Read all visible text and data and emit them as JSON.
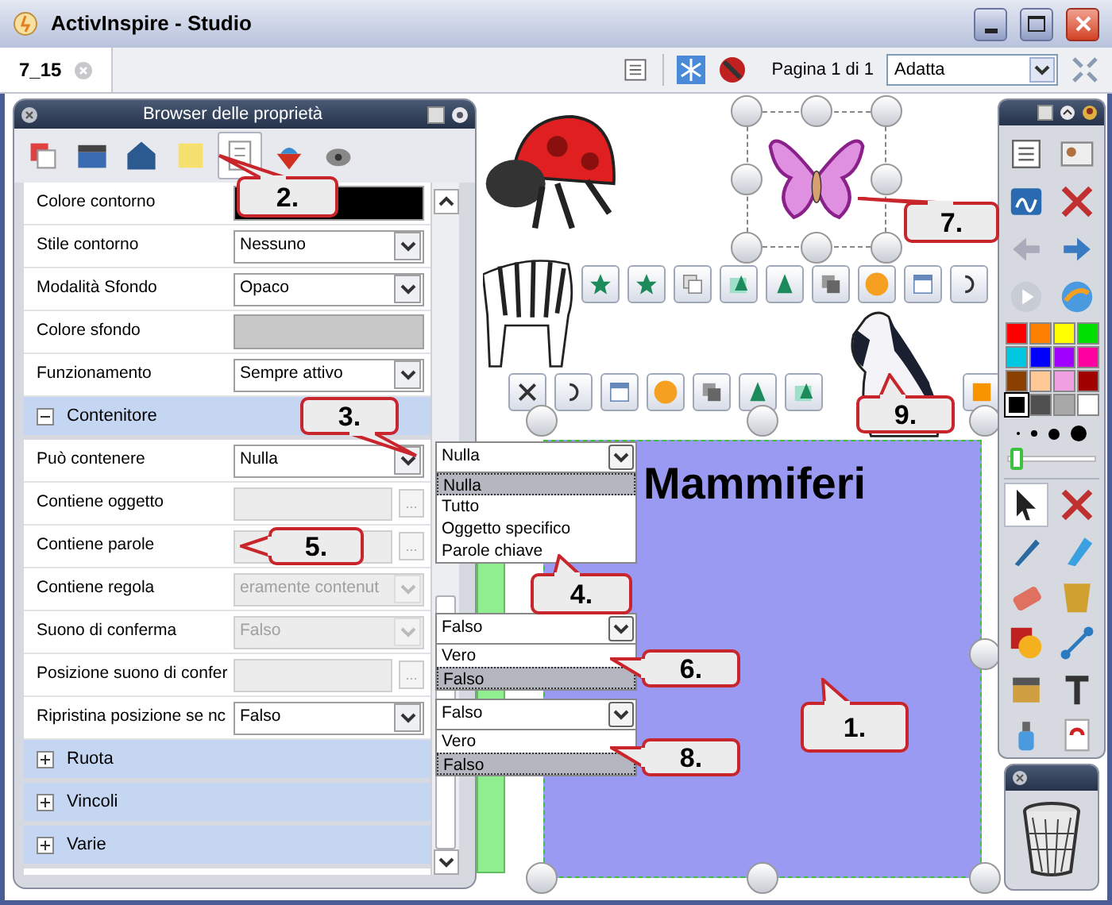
{
  "window": {
    "title": "ActivInspire - Studio"
  },
  "tabs": [
    {
      "label": "7_15",
      "selected": true
    }
  ],
  "toolbar": {
    "page_label": "Pagina 1 di 1",
    "zoom": "Adatta"
  },
  "property_browser": {
    "title": "Browser delle proprietà",
    "tabs": [
      {
        "selected": false
      },
      {
        "selected": false
      },
      {
        "selected": false
      },
      {
        "selected": false
      },
      {
        "selected": true
      },
      {
        "selected": false
      },
      {
        "selected": false
      }
    ],
    "rows": [
      {
        "kind": "color",
        "label": "Colore contorno",
        "color": "#000000",
        "disabled": false
      },
      {
        "kind": "select",
        "label": "Stile contorno",
        "value": "Nessuno",
        "disabled": false
      },
      {
        "kind": "select",
        "label": "Modalità Sfondo",
        "value": "Opaco",
        "disabled": false
      },
      {
        "kind": "color",
        "label": "Colore sfondo",
        "color": "#c8c8c8",
        "disabled": false
      },
      {
        "kind": "select",
        "label": "Funzionamento",
        "value": "Sempre attivo",
        "disabled": false
      },
      {
        "kind": "section",
        "label": "Contenitore",
        "expanded": true,
        "disabled": false
      },
      {
        "kind": "select",
        "label": "Può contenere",
        "value": "Nulla",
        "disabled": false
      },
      {
        "kind": "browse",
        "label": "Contiene oggetto",
        "button": "...",
        "disabled": true
      },
      {
        "kind": "browse",
        "label": "Contiene parole",
        "button": "...",
        "disabled": true
      },
      {
        "kind": "select",
        "label": "Contiene regola",
        "value": "eramente contenut",
        "disabled": true
      },
      {
        "kind": "select",
        "label": "Suono di conferma",
        "value": "Falso",
        "disabled": true
      },
      {
        "kind": "browse",
        "label": "Posizione suono di confer",
        "button": "...",
        "disabled": true
      },
      {
        "kind": "select",
        "label": "Ripristina posizione se nc",
        "value": "Falso",
        "disabled": false
      },
      {
        "kind": "section",
        "label": "Ruota",
        "expanded": false,
        "disabled": false
      },
      {
        "kind": "section",
        "label": "Vincoli",
        "expanded": false,
        "disabled": false
      },
      {
        "kind": "section",
        "label": "Varie",
        "expanded": false,
        "disabled": false
      }
    ]
  },
  "dropdowns": [
    {
      "value": "Nulla",
      "options": [
        {
          "label": "Nulla",
          "selected": true
        },
        {
          "label": "Tutto",
          "selected": false
        },
        {
          "label": "Oggetto specifico",
          "selected": false
        },
        {
          "label": "Parole chiave",
          "selected": false
        }
      ]
    },
    {
      "value": "Falso",
      "options": [
        {
          "label": "Vero",
          "selected": false
        },
        {
          "label": "Falso",
          "selected": true
        }
      ]
    },
    {
      "value": "Falso",
      "options": [
        {
          "label": "Vero",
          "selected": false
        },
        {
          "label": "Falso",
          "selected": true
        }
      ]
    }
  ],
  "canvas": {
    "title": "Mammiferi"
  },
  "callouts": [
    {
      "label": "1."
    },
    {
      "label": "2."
    },
    {
      "label": "3."
    },
    {
      "label": "4."
    },
    {
      "label": "5."
    },
    {
      "label": "6."
    },
    {
      "label": "7."
    },
    {
      "label": "8."
    },
    {
      "label": "9."
    }
  ],
  "toolbox": {
    "palette": [
      {
        "color": "#ff0000",
        "selected": false
      },
      {
        "color": "#ff8000",
        "selected": false
      },
      {
        "color": "#ffff00",
        "selected": false
      },
      {
        "color": "#00e000",
        "selected": false
      },
      {
        "color": "#00c8e0",
        "selected": false
      },
      {
        "color": "#0000ff",
        "selected": false
      },
      {
        "color": "#a000ff",
        "selected": false
      },
      {
        "color": "#ff00a0",
        "selected": false
      },
      {
        "color": "#8b4000",
        "selected": false
      },
      {
        "color": "#ffc896",
        "selected": false
      },
      {
        "color": "#f0a0e0",
        "selected": false
      },
      {
        "color": "#a00000",
        "selected": false
      },
      {
        "color": "#000000",
        "selected": true
      },
      {
        "color": "#505050",
        "selected": false
      },
      {
        "color": "#a8a8a8",
        "selected": false
      },
      {
        "color": "#ffffff",
        "selected": false
      }
    ],
    "width_slider": {
      "level": 0.05
    },
    "tools": [
      {
        "selected": true
      },
      {
        "selected": false
      },
      {
        "selected": false
      },
      {
        "selected": false
      },
      {
        "selected": false
      },
      {
        "selected": false
      },
      {
        "selected": false
      },
      {
        "selected": false
      },
      {
        "selected": false
      },
      {
        "selected": false
      },
      {
        "selected": false
      },
      {
        "selected": false
      }
    ]
  }
}
